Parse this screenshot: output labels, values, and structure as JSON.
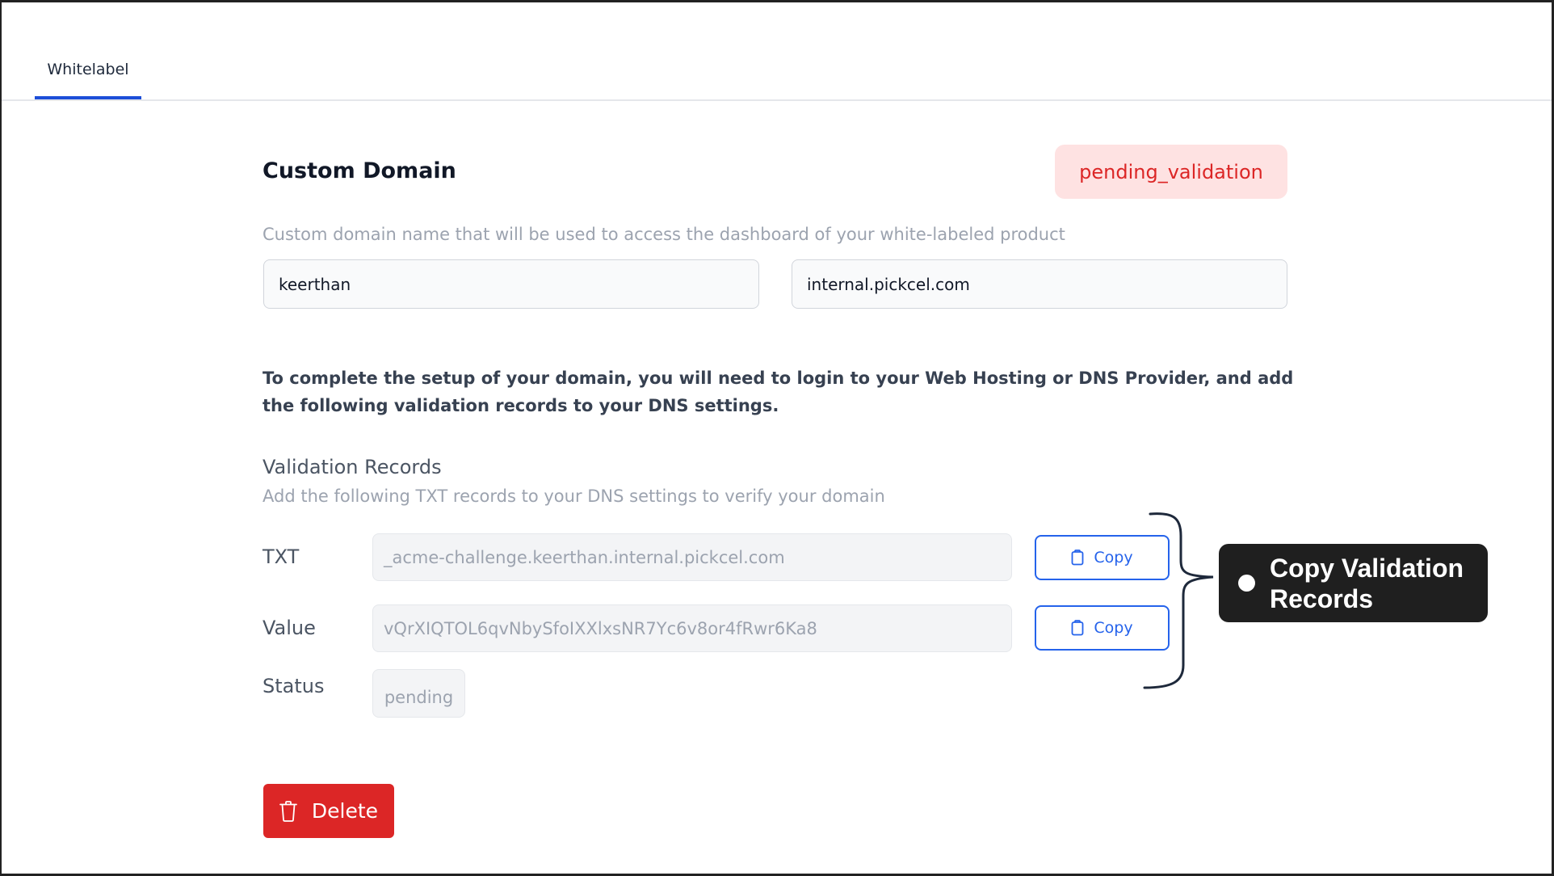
{
  "tabs": [
    {
      "label": "Whitelabel",
      "active": true
    }
  ],
  "custom_domain": {
    "title": "Custom Domain",
    "status_badge": "pending_validation",
    "helper_text": "Custom domain name that will be used to access the dashboard of your white-labeled product",
    "subdomain_value": "keerthan",
    "domain_value": "internal.pickcel.com",
    "instructions": "To complete the setup of your domain, you will need to login to your Web Hosting or DNS Provider, and add the following validation records to your DNS settings."
  },
  "validation_records": {
    "title": "Validation Records",
    "subtitle": "Add the following TXT records to your DNS settings to verify your domain",
    "rows": [
      {
        "label": "TXT",
        "value": "_acme-challenge.keerthan.internal.pickcel.com",
        "copy_label": "Copy",
        "icon": "clipboard-icon"
      },
      {
        "label": "Value",
        "value": "vQrXIQTOL6qvNbySfoIXXlxsNR7Yc6v8or4fRwr6Ka8",
        "copy_label": "Copy",
        "icon": "clipboard-icon"
      }
    ],
    "status_label": "Status",
    "status_value": "pending"
  },
  "annotation": {
    "text": "Copy Validation Records"
  },
  "actions": {
    "delete_label": "Delete",
    "delete_icon": "trash-icon"
  },
  "colors": {
    "accent": "#2563eb",
    "tab_indicator": "#1d4ed8",
    "danger": "#dc2626",
    "badge_bg": "#fee2e2",
    "callout_bg": "#1f1f1f"
  }
}
